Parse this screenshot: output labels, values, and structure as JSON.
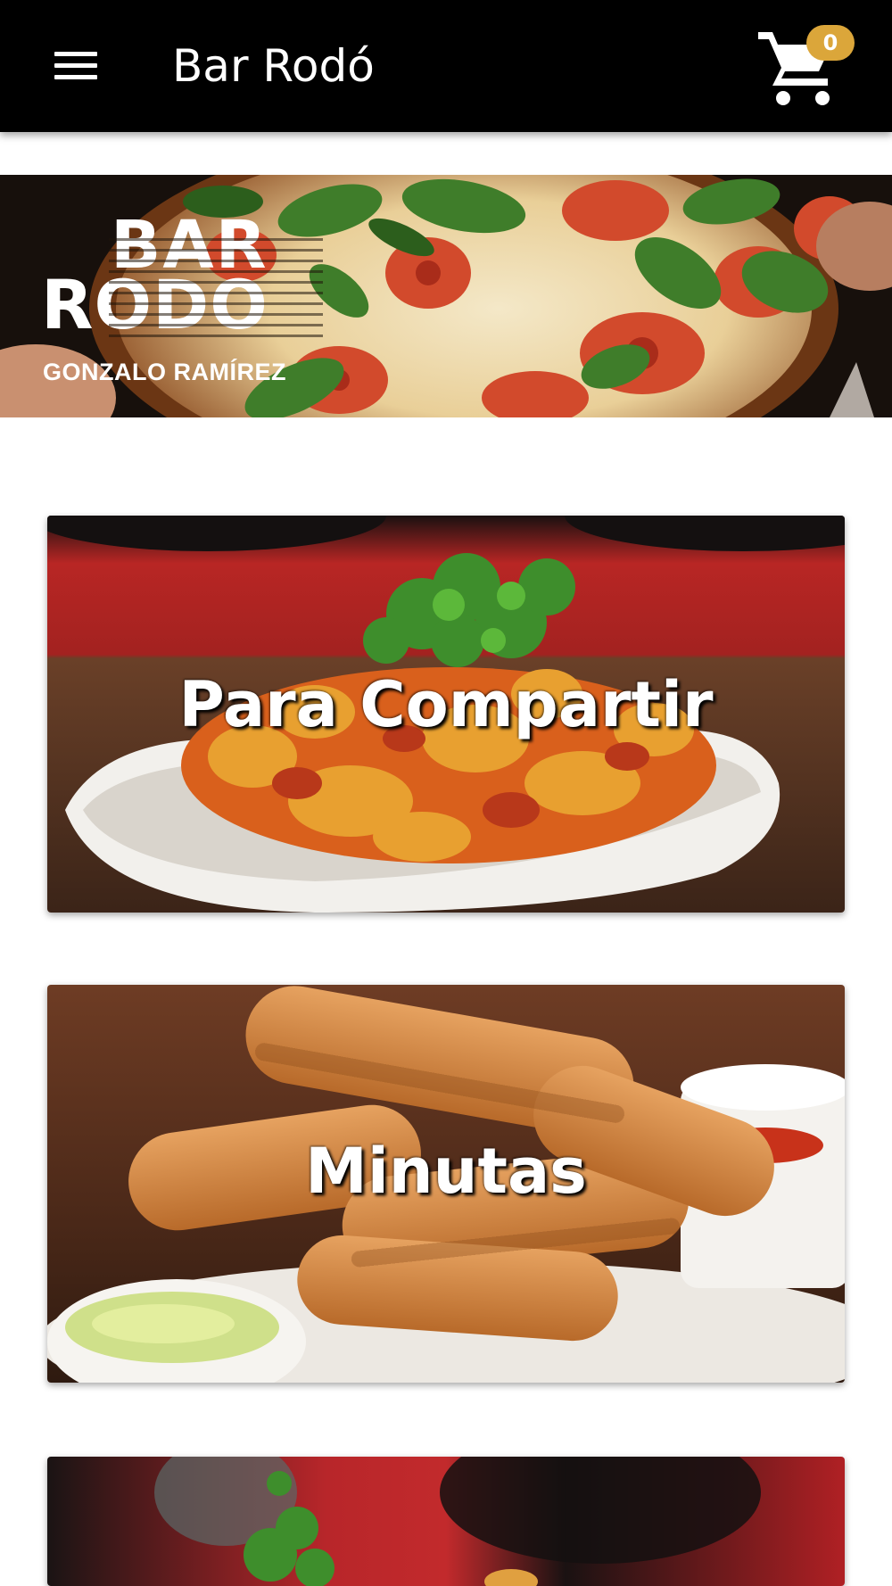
{
  "app_bar": {
    "title": "Bar Rodó",
    "cart_count": "0"
  },
  "hero": {
    "logo_line1": "BAR",
    "logo_line2": "RODO",
    "logo_line3": "GONZALO RAMÍREZ"
  },
  "categories": [
    {
      "label": "Para Compartir"
    },
    {
      "label": "Minutas"
    },
    {
      "label": ""
    }
  ],
  "colors": {
    "app_bar_bg": "#000000",
    "badge": "#dba63a"
  }
}
